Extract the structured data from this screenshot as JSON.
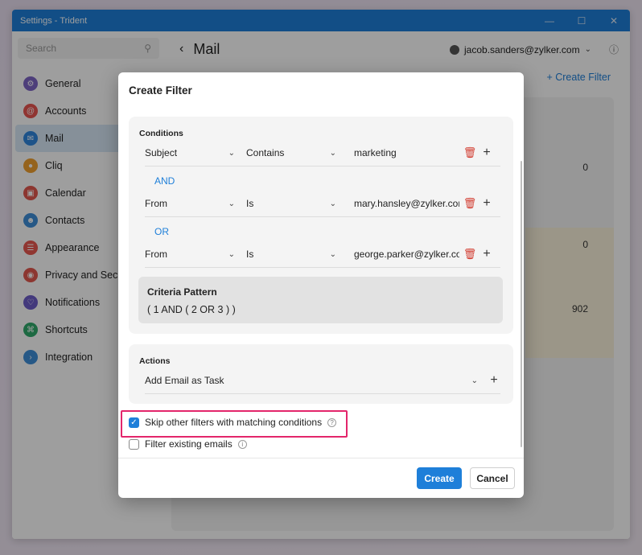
{
  "window": {
    "title": "Settings - Trident"
  },
  "sidebar": {
    "search_placeholder": "Search",
    "items": [
      {
        "label": "General",
        "icon": "gear-icon",
        "color": "#7d64c5"
      },
      {
        "label": "Accounts",
        "icon": "at-icon",
        "color": "#e8544f"
      },
      {
        "label": "Mail",
        "icon": "mail-icon",
        "color": "#2f86dd",
        "active": true
      },
      {
        "label": "Cliq",
        "icon": "chat-icon",
        "color": "#f0a030"
      },
      {
        "label": "Calendar",
        "icon": "calendar-icon",
        "color": "#e3584e"
      },
      {
        "label": "Contacts",
        "icon": "contacts-icon",
        "color": "#3e8fd8"
      },
      {
        "label": "Appearance",
        "icon": "appearance-icon",
        "color": "#e8584f"
      },
      {
        "label": "Privacy and Security",
        "icon": "shield-icon",
        "color": "#e3584e"
      },
      {
        "label": "Notifications",
        "icon": "bell-icon",
        "color": "#6c5dc9"
      },
      {
        "label": "Shortcuts",
        "icon": "command-icon",
        "color": "#2faa6b"
      },
      {
        "label": "Integration",
        "icon": "integration-icon",
        "color": "#3e8fd8"
      }
    ]
  },
  "main": {
    "title": "Mail",
    "account": "jacob.sanders@zylker.com",
    "create_filter": "+ Create Filter",
    "row_values": [
      "0",
      "0",
      "902"
    ]
  },
  "dialog": {
    "title": "Create Filter",
    "conditions_label": "Conditions",
    "conditions": [
      {
        "field": "Subject",
        "operator": "Contains",
        "value": "marketing"
      },
      {
        "field": "From",
        "operator": "Is",
        "value": "mary.hansley@zylker.com"
      },
      {
        "field": "From",
        "operator": "Is",
        "value": "george.parker@zylker.com"
      }
    ],
    "joiners": [
      "AND",
      "OR"
    ],
    "criteria_label": "Criteria Pattern",
    "criteria_value": "( 1 AND ( 2 OR 3 ) )",
    "actions_label": "Actions",
    "action_value": "Add Email as Task",
    "skip_label": "Skip other filters with matching conditions",
    "skip_checked": true,
    "existing_label": "Filter existing emails",
    "existing_checked": false,
    "create_label": "Create",
    "cancel_label": "Cancel"
  }
}
